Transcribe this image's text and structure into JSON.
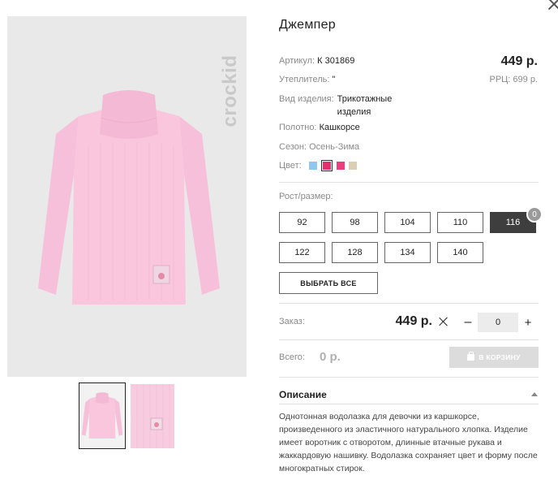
{
  "product": {
    "title": "Джемпер",
    "brand_logo": "crockid",
    "price": "449 р.",
    "rrp": "РРЦ: 699 р."
  },
  "attributes": [
    {
      "label": "Артикул:",
      "value": "К 301869"
    },
    {
      "label": "Утеплитель:",
      "value": "\""
    },
    {
      "label": "Вид изделия:",
      "value": "Трикотажные изделия"
    },
    {
      "label": "Полотно:",
      "value": "Кашкорсе"
    },
    {
      "label": "Сезон:",
      "value": "Осень-Зима"
    },
    {
      "label": "Цвет:",
      "value": ""
    }
  ],
  "colors": [
    {
      "name": "light-blue",
      "hex": "#8fc7f0",
      "selected": false
    },
    {
      "name": "magenta",
      "hex": "#e0306e",
      "selected": true
    },
    {
      "name": "pink",
      "hex": "#ec3d7d",
      "selected": false
    },
    {
      "name": "beige",
      "hex": "#dacfb4",
      "selected": false
    }
  ],
  "sizes": {
    "label": "Рост/размер:",
    "options": [
      "92",
      "98",
      "104",
      "110",
      "116",
      "122",
      "128",
      "134",
      "140"
    ],
    "selected": "116",
    "selected_badge": "0",
    "select_all_label": "ВЫБРАТЬ ВСЕ"
  },
  "order": {
    "label": "Заказ:",
    "price": "449 р.",
    "quantity": "0",
    "minus": "–",
    "plus": "+"
  },
  "total": {
    "label": "Всего:",
    "value": "0 р.",
    "cart_button": "В КОРЗИНУ"
  },
  "description": {
    "title": "Описание",
    "text": "Однотонная водолазка для девочки из каршкорсе, произведенного из эластичного натурального хлопка. Изделие имеет воротник с отворотом, длинные втачные рукава и жаккардовую нашивку. Водолазка сохраняет цвет и форму после многократных стирок."
  },
  "icons": {
    "close": "close-icon",
    "cart": "cart-icon",
    "multiply": "times-icon",
    "collapse": "chevron-up-icon"
  },
  "colors_ui": {
    "selected_size_bg": "#3e3e3e",
    "cart_button_bg": "#dcdcdc",
    "product_pink": "#f8c3db"
  }
}
